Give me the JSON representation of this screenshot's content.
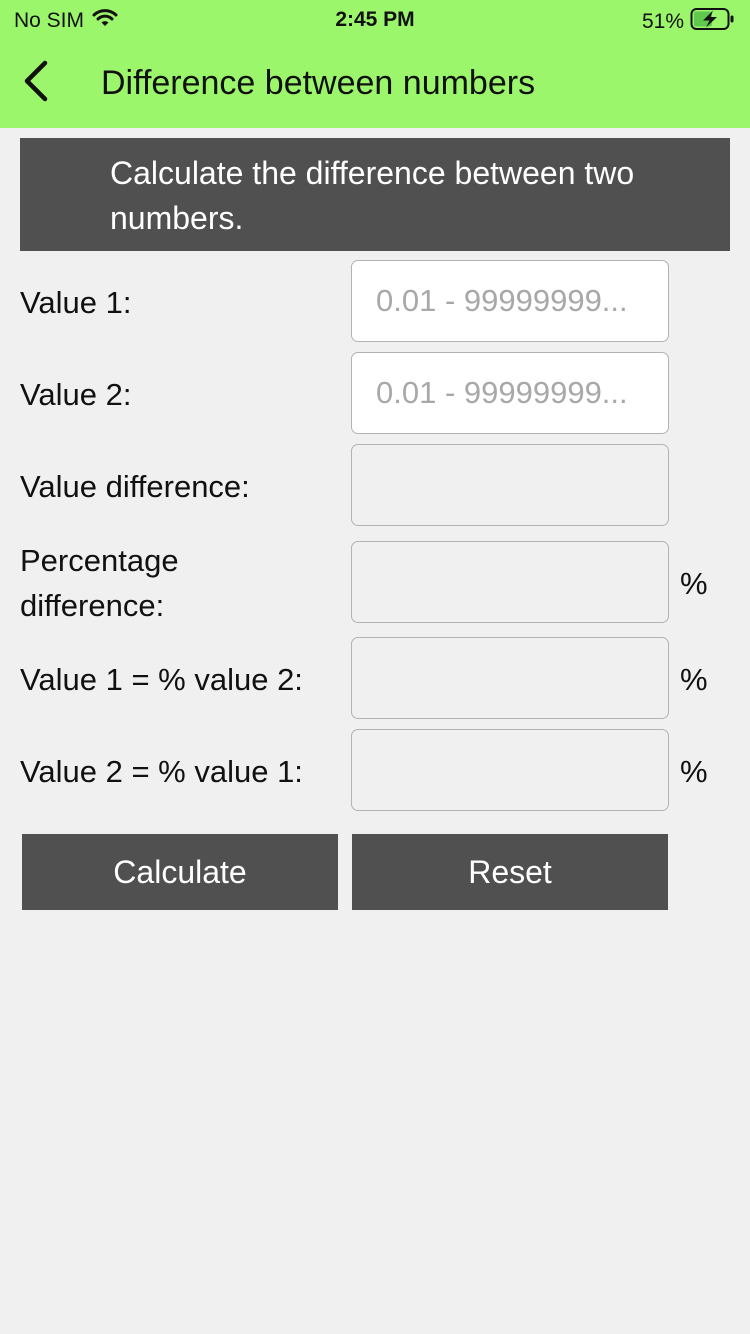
{
  "status_bar": {
    "carrier": "No SIM",
    "time": "2:45 PM",
    "battery": "51%"
  },
  "nav": {
    "title": "Difference between numbers"
  },
  "banner": {
    "text": "Calculate the difference between two numbers."
  },
  "form": {
    "value1": {
      "label": "Value 1:",
      "placeholder": "0.01 - 99999999..."
    },
    "value2": {
      "label": "Value 2:",
      "placeholder": "0.01 - 99999999..."
    },
    "value_difference": {
      "label": "Value difference:"
    },
    "percentage_difference": {
      "label": "Percentage difference:",
      "unit": "%"
    },
    "v1_pct_v2": {
      "label": "Value 1 = % value 2:",
      "unit": "%"
    },
    "v2_pct_v1": {
      "label": "Value 2 = % value 1:",
      "unit": "%"
    }
  },
  "buttons": {
    "calculate": "Calculate",
    "reset": "Reset"
  },
  "colors": {
    "header": "#9cf66b",
    "dark": "#505050",
    "background": "#f0f0f0"
  },
  "icons": {
    "wifi": "wifi-icon",
    "battery": "battery-charging-icon",
    "back": "chevron-left-icon"
  }
}
